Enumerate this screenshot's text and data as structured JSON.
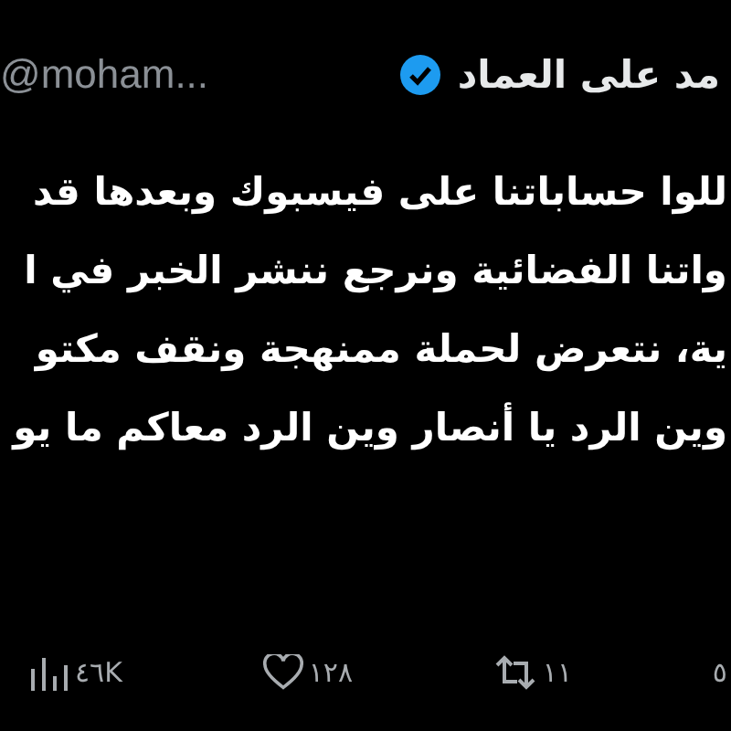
{
  "author": {
    "name": "مد على العماد",
    "verified": true,
    "handle": "@moham..."
  },
  "tweet": {
    "lines": [
      "للوا حساباتنا على فيسبوك وبعدها  قد",
      "واتنا الفضائية ونرجع ننشر الخبر في ا",
      "ية، نتعرض لحملة ممنهجة ونقف مكتو",
      "وين الرد يا أنصار وين الرد معاكم ما يو"
    ]
  },
  "actions": [
    {
      "kind": "replies",
      "count": "٥"
    },
    {
      "kind": "retweets",
      "count": "١١"
    },
    {
      "kind": "likes",
      "count": "١٢٨"
    },
    {
      "kind": "views",
      "count": "٤٦K"
    }
  ]
}
